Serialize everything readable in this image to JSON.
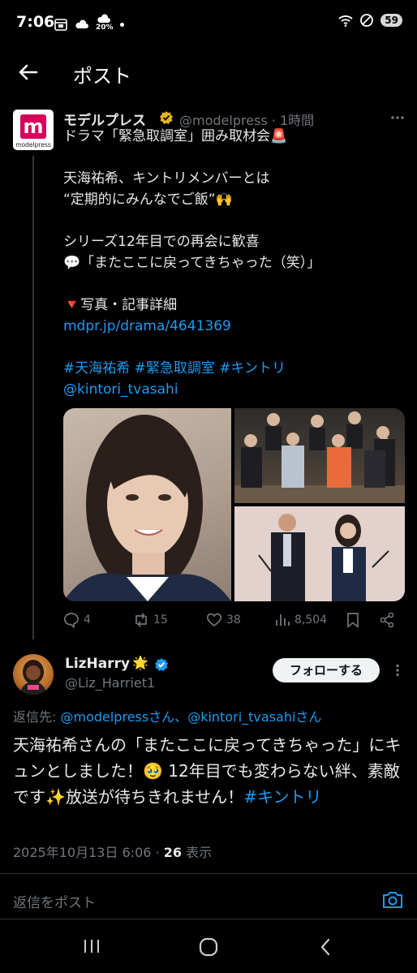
{
  "status_bar": {
    "time": "7:06",
    "temperature": "20%",
    "battery": "59",
    "icons": [
      "calendar-icon",
      "cloud-icon",
      "weather-icon",
      "wifi-icon",
      "dnd-icon"
    ]
  },
  "header": {
    "title": "ポスト",
    "back_icon": "arrow-left-icon"
  },
  "post": {
    "author_name": "モデルプレス",
    "avatar_letter": "m",
    "avatar_brand": "modelpress",
    "handle": "@modelpress · 1時間",
    "lines": [
      "ドラマ「緊急取調室」囲み取材会🚨",
      "",
      "天海祐希、キントリメンバーとは",
      "“定期的にみんなでご飯”🙌",
      "",
      "シリーズ12年目での再会に歓喜",
      "💬「またここに戻ってきちゃった（笑）」",
      "",
      "🔻写真・記事詳細"
    ],
    "link": "mdpr.jp/drama/4641369",
    "hashtags": "#天海祐希 #緊急取調室 #キントリ",
    "mention": "@kintori_tvasahi",
    "stats": {
      "replies": "4",
      "reposts": "15",
      "likes": "38",
      "views": "8,504"
    }
  },
  "reply": {
    "author_name": "LizHarry",
    "name_emoji": "🌟",
    "handle": "@Liz_Harriet1",
    "follow_label": "フォローする",
    "reply_to_prefix": "返信先: ",
    "reply_to_users": "@modelpressさん、@kintori_tvasahiさん",
    "text": "天海祐希さんの「またここに戻ってきちゃった」にキュンとしました！🥹 12年目でも変わらない絆、素敵です✨放送が待ちきれません！",
    "text_hashtag": "#キントリ",
    "date": "2025年10月13日 6:06 · ",
    "views_count": "26",
    "views_label": " 表示"
  },
  "compose": {
    "placeholder": "返信をポスト",
    "camera_icon": "camera-icon"
  },
  "nav": {
    "icons": [
      "recent-apps-icon",
      "home-icon",
      "back-icon"
    ]
  },
  "colors": {
    "background": "#000000",
    "link": "#1d9bf0",
    "muted": "#71767b",
    "brand": "#d6005a",
    "verified_gold": "#e2b719",
    "verified_blue": "#1d9bf0"
  }
}
